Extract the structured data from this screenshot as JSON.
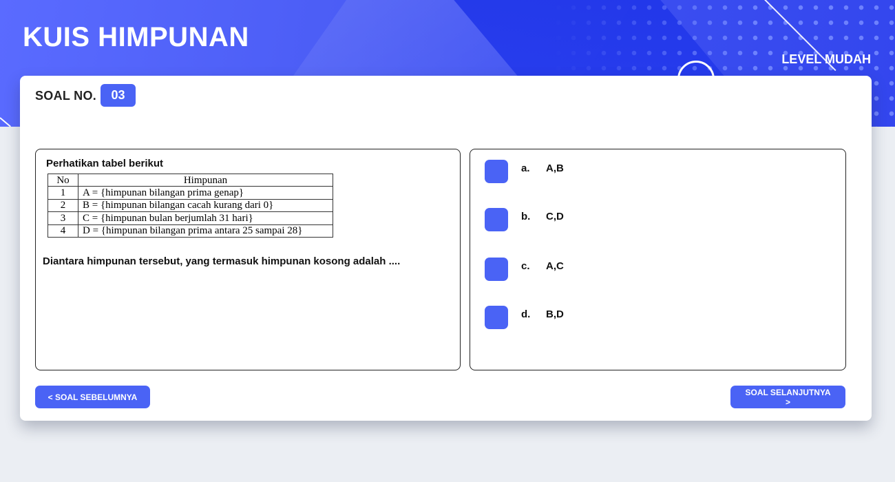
{
  "header": {
    "title": "KUIS HIMPUNAN",
    "level": "LEVEL MUDAH"
  },
  "question": {
    "number_label": "SOAL NO.",
    "number": "03",
    "intro": "Perhatikan tabel berikut",
    "table": {
      "headers": [
        "No",
        "Himpunan"
      ],
      "rows": [
        [
          "1",
          "A = {himpunan bilangan prima genap}"
        ],
        [
          "2",
          "B = {himpunan bilangan cacah kurang dari 0}"
        ],
        [
          "3",
          "C = {himpunan bulan berjumlah 31 hari}"
        ],
        [
          "4",
          "D = {himpunan bilangan prima antara 25 sampai 28}"
        ]
      ]
    },
    "text": "Diantara himpunan tersebut, yang termasuk himpunan kosong adalah ...."
  },
  "options": [
    {
      "letter": "a.",
      "answer": "A,B"
    },
    {
      "letter": "b.",
      "answer": "C,D"
    },
    {
      "letter": "c.",
      "answer": "A,C"
    },
    {
      "letter": "d.",
      "answer": "B,D"
    }
  ],
  "navigation": {
    "prev_label": "< SOAL SEBELUMNYA",
    "next_label": "SOAL SELANJUTNYA >"
  },
  "colors": {
    "accent": "#4a63f5",
    "header_gradient_start": "#5a6bff",
    "header_gradient_end": "#3346ee",
    "page_bg": "#ebeef3"
  }
}
